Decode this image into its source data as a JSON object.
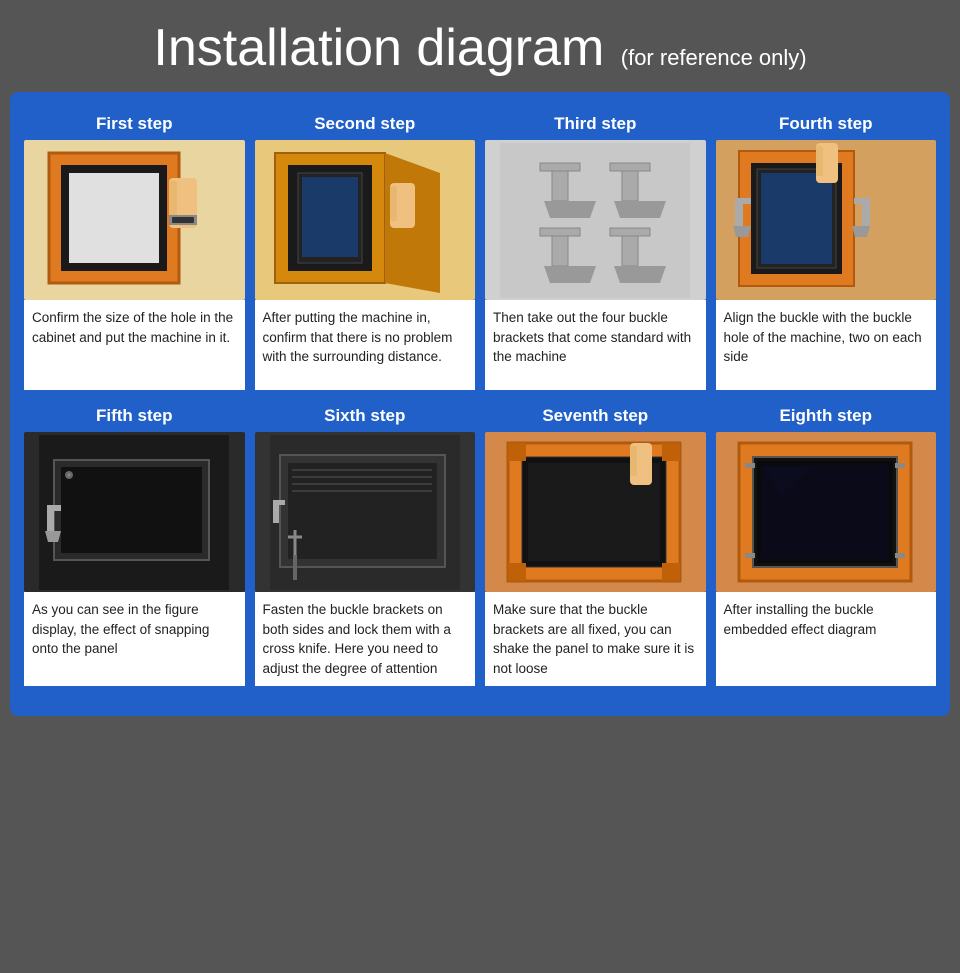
{
  "header": {
    "title": "Installation diagram",
    "subtitle": "(for reference only)"
  },
  "steps": [
    {
      "id": "step1",
      "label": "First step",
      "description": "Confirm the size of the hole in the cabinet and put the machine in it.",
      "img_class": "img-step1"
    },
    {
      "id": "step2",
      "label": "Second step",
      "description": "After putting the machine in, confirm that there is no problem with the surrounding distance.",
      "img_class": "img-step2"
    },
    {
      "id": "step3",
      "label": "Third step",
      "description": "Then take out the four buckle brackets that come standard with the machine",
      "img_class": "img-step3"
    },
    {
      "id": "step4",
      "label": "Fourth step",
      "description": "Align the buckle with the buckle hole of the machine, two on each side",
      "img_class": "img-step4"
    },
    {
      "id": "step5",
      "label": "Fifth step",
      "description": "As you can see in the figure display, the effect of snapping onto the panel",
      "img_class": "img-step5"
    },
    {
      "id": "step6",
      "label": "Sixth step",
      "description": "Fasten the buckle brackets on both sides and lock them with a cross knife. Here you need to adjust the degree of attention",
      "img_class": "img-step6"
    },
    {
      "id": "step7",
      "label": "Seventh step",
      "description": "Make sure that the buckle brackets are all fixed, you can shake the panel to make sure it is not loose",
      "img_class": "img-step7"
    },
    {
      "id": "step8",
      "label": "Eighth step",
      "description": "After installing the buckle embedded effect diagram",
      "img_class": "img-step8"
    }
  ],
  "colors": {
    "background_header": "#555555",
    "background_main": "#2060c8",
    "text_title": "#ffffff",
    "text_subtitle": "#ffffff",
    "text_step_label": "#ffffff",
    "text_desc": "#222222",
    "cell_bg": "#ffffff"
  }
}
